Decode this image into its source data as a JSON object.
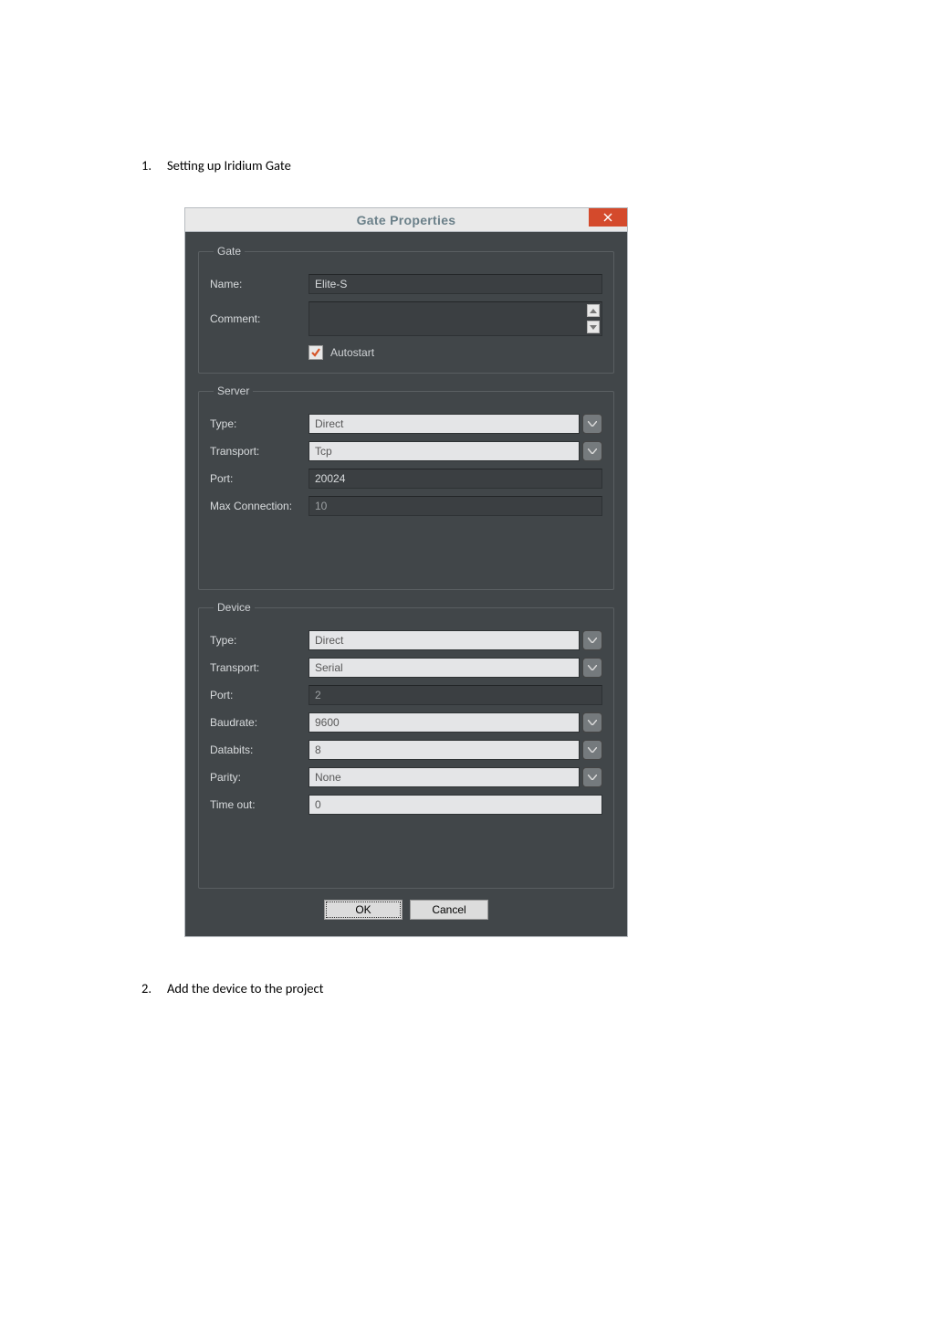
{
  "doc": {
    "items": [
      {
        "num": "1.",
        "text": "Setting up Iridium Gate"
      },
      {
        "num": "2.",
        "text": "Add the device to the project"
      }
    ]
  },
  "dialog": {
    "title": "Gate Properties",
    "buttons": {
      "ok": "OK",
      "cancel": "Cancel"
    },
    "gate": {
      "legend": "Gate",
      "name_label": "Name:",
      "name_value": "Elite-S",
      "comment_label": "Comment:",
      "comment_value": "",
      "autostart_label": "Autostart",
      "autostart_checked": true
    },
    "server": {
      "legend": "Server",
      "type_label": "Type:",
      "type_value": "Direct",
      "transport_label": "Transport:",
      "transport_value": "Tcp",
      "port_label": "Port:",
      "port_value": "20024",
      "maxconn_label": "Max Connection:",
      "maxconn_value": "10"
    },
    "device": {
      "legend": "Device",
      "type_label": "Type:",
      "type_value": "Direct",
      "transport_label": "Transport:",
      "transport_value": "Serial",
      "port_label": "Port:",
      "port_value": "2",
      "baudrate_label": "Baudrate:",
      "baudrate_value": "9600",
      "databits_label": "Databits:",
      "databits_value": "8",
      "parity_label": "Parity:",
      "parity_value": "None",
      "timeout_label": "Time out:",
      "timeout_value": "0"
    }
  }
}
